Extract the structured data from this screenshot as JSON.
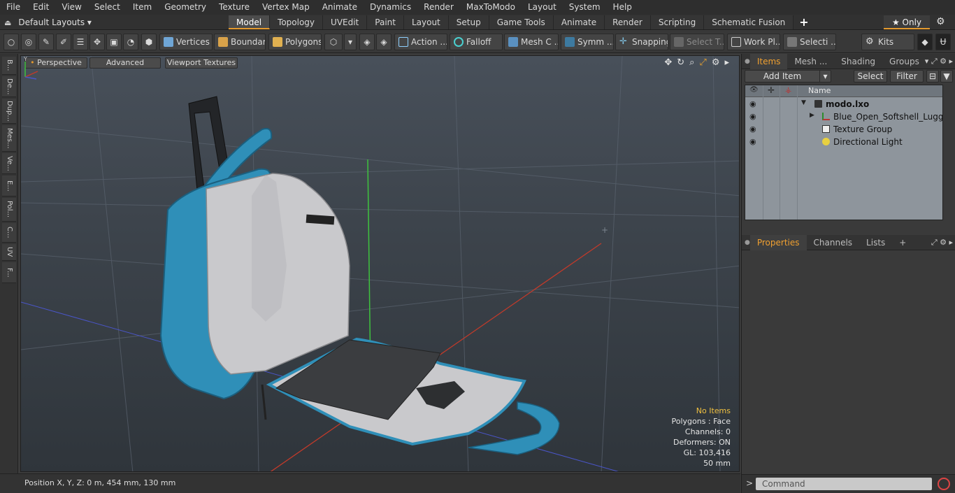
{
  "menu": [
    "File",
    "Edit",
    "View",
    "Select",
    "Item",
    "Geometry",
    "Texture",
    "Vertex Map",
    "Animate",
    "Dynamics",
    "Render",
    "MaxToModo",
    "Layout",
    "System",
    "Help"
  ],
  "layouts": {
    "label": "Default Layouts ▾"
  },
  "tabs": [
    "Model",
    "Topology",
    "UVEdit",
    "Paint",
    "Layout",
    "Setup",
    "Game Tools",
    "Animate",
    "Render",
    "Scripting",
    "Schematic Fusion"
  ],
  "active_tab": "Model",
  "only_button": "★  Only",
  "toolbar": {
    "vertices": "Vertices",
    "boundary": "Boundary",
    "polygons": "Polygons",
    "action": "Action ...",
    "falloff": "Falloff",
    "mesh": "Mesh C ...",
    "symm": "Symm ...",
    "snapping": "Snapping",
    "select_t": "Select T...",
    "workpl": "Work Pl...",
    "selecti": "Selecti ...",
    "kits": "Kits"
  },
  "left_tabs": [
    "B...",
    "De...",
    "Dup...",
    "Mes...",
    "Ve...",
    "E...",
    "Pol...",
    "C...",
    "UV",
    "F..."
  ],
  "viewport": {
    "perspective": "Perspective",
    "advanced": "Advanced",
    "textures": "Viewport Textures",
    "info": {
      "no_items": "No Items",
      "polygons": "Polygons : Face",
      "channels": "Channels: 0",
      "deformers": "Deformers: ON",
      "gl": "GL: 103,416",
      "scale": "50 mm"
    }
  },
  "status": {
    "position": "Position X, Y, Z:   0 m, 454 mm, 130 mm"
  },
  "items_panel": {
    "tabs": [
      "Items",
      "Mesh ...",
      "Shading",
      "Groups"
    ],
    "add_item": "Add Item",
    "select": "Select",
    "filter": "Filter",
    "column_name": "Name",
    "rows": [
      "modo.lxo",
      "Blue_Open_Softshell_Luggage",
      "Texture Group",
      "Directional Light"
    ]
  },
  "props_panel": {
    "tabs": [
      "Properties",
      "Channels",
      "Lists"
    ]
  },
  "command": {
    "placeholder": "Command"
  },
  "colors": {
    "accent": "#e59a2e",
    "luggage_blue": "#2f8fb8",
    "lining": "#c9c9cc"
  }
}
